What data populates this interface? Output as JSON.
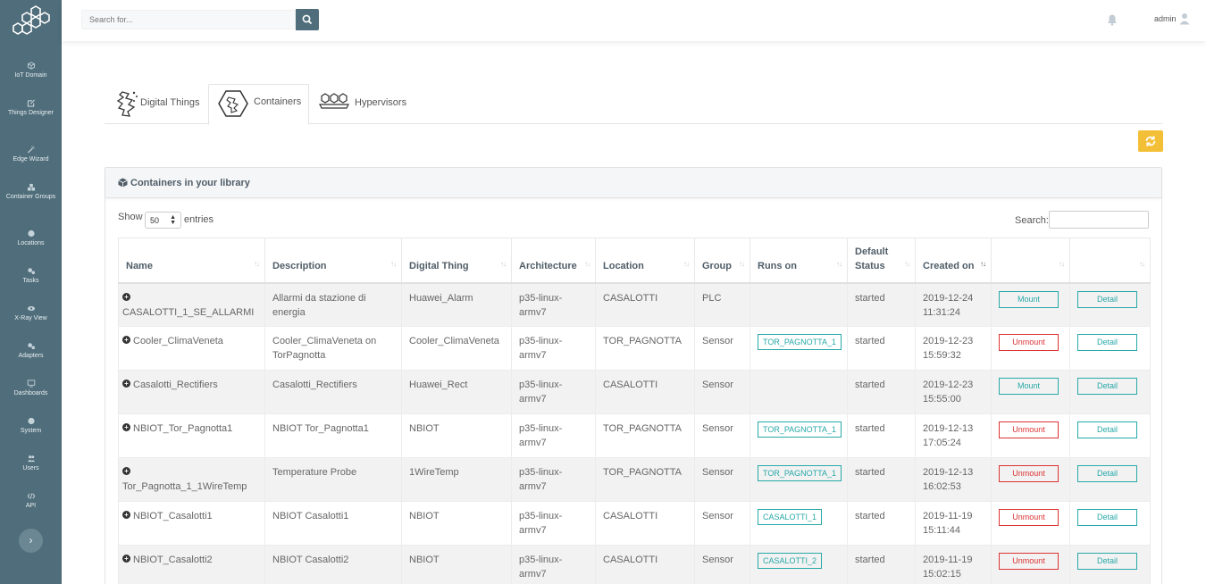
{
  "topbar": {
    "search_placeholder": "Search for...",
    "user_name": "admin"
  },
  "sidebar": {
    "items": [
      {
        "label": "IoT Domain",
        "icon": "cube-icon"
      },
      {
        "label": "Things Designer",
        "icon": "edit-icon"
      },
      {
        "label": "Edge Wizard",
        "icon": "wand-icon"
      },
      {
        "label": "Container Groups",
        "icon": "cubes-icon"
      },
      {
        "label": "Locations",
        "icon": "globe-icon"
      },
      {
        "label": "Tasks",
        "icon": "cogs-icon"
      },
      {
        "label": "X-Ray View",
        "icon": "eye-icon"
      },
      {
        "label": "Adapters",
        "icon": "cogs-icon"
      },
      {
        "label": "Dashboards",
        "icon": "monitor-icon"
      },
      {
        "label": "System",
        "icon": "globe-icon"
      },
      {
        "label": "Users",
        "icon": "users-icon"
      },
      {
        "label": "API",
        "icon": "code-icon"
      }
    ],
    "expand_label": "›"
  },
  "tabs": [
    {
      "label": "Digital Things",
      "active": false
    },
    {
      "label": "Containers",
      "active": true
    },
    {
      "label": "Hypervisors",
      "active": false
    }
  ],
  "panel": {
    "title": "Containers in your library"
  },
  "datatable": {
    "show_label": "Show",
    "page_length": "50",
    "entries_label": "entries",
    "search_label": "Search:",
    "columns": [
      "Name",
      "Description",
      "Digital Thing",
      "Architecture",
      "Location",
      "Group",
      "Runs on",
      "Default Status",
      "Created on",
      "",
      ""
    ],
    "rows": [
      {
        "name": "CASALOTTI_1_SE_ALLARMI",
        "description": "Allarmi da stazione di energia",
        "thing": "Huawei_Alarm",
        "arch": "p35-linux-armv7",
        "location": "CASALOTTI",
        "group": "PLC",
        "runs_on": "",
        "status": "started",
        "created": "2019-12-24 11:31:24",
        "action": "Mount",
        "detail": "Detail"
      },
      {
        "name": "Cooler_ClimaVeneta",
        "description": "Cooler_ClimaVeneta on TorPagnotta",
        "thing": "Cooler_ClimaVeneta",
        "arch": "p35-linux-armv7",
        "location": "TOR_PAGNOTTA",
        "group": "Sensor",
        "runs_on": "TOR_PAGNOTTA_1",
        "status": "started",
        "created": "2019-12-23 15:59:32",
        "action": "Unmount",
        "detail": "Detail"
      },
      {
        "name": "Casalotti_Rectifiers",
        "description": "Casalotti_Rectifiers",
        "thing": "Huawei_Rect",
        "arch": "p35-linux-armv7",
        "location": "CASALOTTI",
        "group": "Sensor",
        "runs_on": "",
        "status": "started",
        "created": "2019-12-23 15:55:00",
        "action": "Mount",
        "detail": "Detail"
      },
      {
        "name": "NBIOT_Tor_Pagnotta1",
        "description": "NBIOT Tor_Pagnotta1",
        "thing": "NBIOT",
        "arch": "p35-linux-armv7",
        "location": "TOR_PAGNOTTA",
        "group": "Sensor",
        "runs_on": "TOR_PAGNOTTA_1",
        "status": "started",
        "created": "2019-12-13 17:05:24",
        "action": "Unmount",
        "detail": "Detail"
      },
      {
        "name": "Tor_Pagnotta_1_1WireTemp",
        "description": "Temperature Probe",
        "thing": "1WireTemp",
        "arch": "p35-linux-armv7",
        "location": "TOR_PAGNOTTA",
        "group": "Sensor",
        "runs_on": "TOR_PAGNOTTA_1",
        "status": "started",
        "created": "2019-12-13 16:02:53",
        "action": "Unmount",
        "detail": "Detail"
      },
      {
        "name": "NBIOT_Casalotti1",
        "description": "NBIOT Casalotti1",
        "thing": "NBIOT",
        "arch": "p35-linux-armv7",
        "location": "CASALOTTI",
        "group": "Sensor",
        "runs_on": "CASALOTTI_1",
        "status": "started",
        "created": "2019-11-19 15:11:44",
        "action": "Unmount",
        "detail": "Detail"
      },
      {
        "name": "NBIOT_Casalotti2",
        "description": "NBIOT Casalotti2",
        "thing": "NBIOT",
        "arch": "p35-linux-armv7",
        "location": "CASALOTTI",
        "group": "Sensor",
        "runs_on": "CASALOTTI_2",
        "status": "started",
        "created": "2019-11-19 15:02:15",
        "action": "Unmount",
        "detail": "Detail"
      }
    ]
  },
  "colors": {
    "sidebar": "#4f6d7a",
    "accent_teal": "#28a8a8",
    "danger": "#dd3333",
    "refresh": "#f3bf36"
  }
}
